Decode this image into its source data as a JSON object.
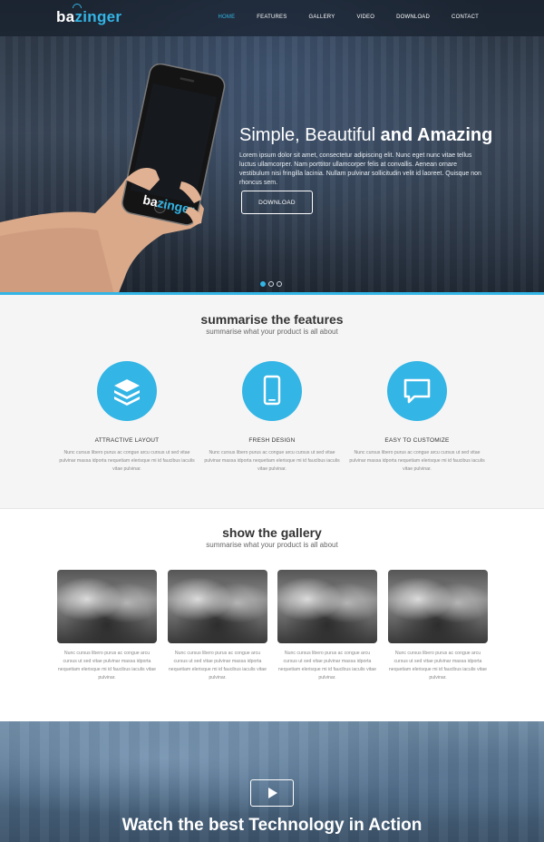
{
  "brand": {
    "name_prefix": "ba",
    "name_suffix": "zinger",
    "accent_color": "#33b5e5"
  },
  "nav": {
    "items": [
      {
        "label": "HOME",
        "active": true
      },
      {
        "label": "FEATURES",
        "active": false
      },
      {
        "label": "GALLERY",
        "active": false
      },
      {
        "label": "VIDEO",
        "active": false
      },
      {
        "label": "DOWNLOAD",
        "active": false
      },
      {
        "label": "CONTACT",
        "active": false
      }
    ]
  },
  "hero": {
    "headline_light": "Simple, Beautiful ",
    "headline_bold": "and Amazing",
    "lead": "Lorem ipsum dolor sit amet, consectetur adipiscing elit. Nunc eget nunc vitae tellus luctus ullamcorper. Nam porttitor ullamcorper felis at convallis. Aenean ornare vestibulum nisi fringilla lacinia. Nullam pulvinar sollicitudin velit id laoreet. Quisque non rhoncus sem.",
    "button_label": "DOWNLOAD",
    "phone_logo_prefix": "ba",
    "phone_logo_suffix": "zinger",
    "slides_total": 3,
    "slide_active": 1
  },
  "features": {
    "title": "summarise the features",
    "subtitle": "summarise what your product is all about",
    "items": [
      {
        "icon": "layers-icon",
        "name": "ATTRACTIVE LAYOUT",
        "text": "Nunc cursus libero purus ac congue arcu cursus ut sed vitae pulvinar massa idporta nequetiam elerisque mi id faucibus iaculis vitae pulvinar."
      },
      {
        "icon": "tablet-icon",
        "name": "FRESH DESIGN",
        "text": "Nunc cursus libero purus ac congue arcu cursus ut sed vitae pulvinar massa idporta nequetiam elerisque mi id faucibus iaculis vitae pulvinar."
      },
      {
        "icon": "chat-icon",
        "name": "EASY TO CUSTOMIZE",
        "text": "Nunc cursus libero purus ac congue arcu cursus ut sed vitae pulvinar massa idporta nequetiam elerisque mi id faucibus iaculis vitae pulvinar."
      }
    ]
  },
  "gallery": {
    "title": "show the gallery",
    "subtitle": "summarise what your product is all about",
    "items": [
      {
        "text": "Nunc cursus libero purus ac congue arcu cursus ut sed vitae pulvinar massa idporta nequetiam elerisque mi id faucibus iaculis vitae pulvinar."
      },
      {
        "text": "Nunc cursus libero purus ac congue arcu cursus ut sed vitae pulvinar massa idporta nequetiam elerisque mi id faucibus iaculis vitae pulvinar."
      },
      {
        "text": "Nunc cursus libero purus ac congue arcu cursus ut sed vitae pulvinar massa idporta nequetiam elerisque mi id faucibus iaculis vitae pulvinar."
      },
      {
        "text": "Nunc cursus libero purus ac congue arcu cursus ut sed vitae pulvinar massa idporta nequetiam elerisque mi id faucibus iaculis vitae pulvinar."
      }
    ]
  },
  "video": {
    "title_light": "Watch the best Technology in ",
    "title_bold": "Action",
    "play_icon": "play-icon"
  }
}
